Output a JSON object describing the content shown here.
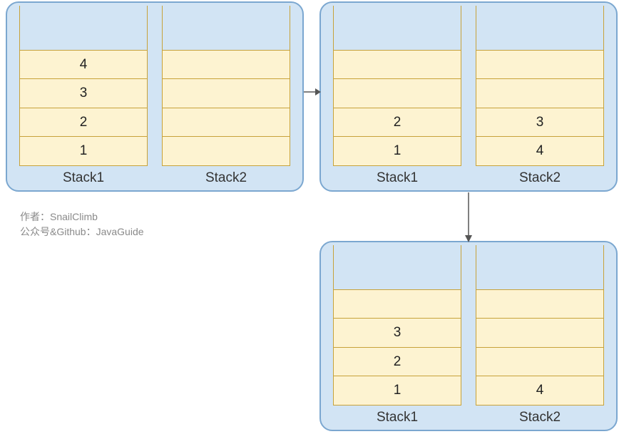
{
  "labels": {
    "stack1": "Stack1",
    "stack2": "Stack2"
  },
  "panels": [
    {
      "id": "panel-1",
      "stack1": [
        "1",
        "2",
        "3",
        "4"
      ],
      "stack2": []
    },
    {
      "id": "panel-2",
      "stack1": [
        "1",
        "2"
      ],
      "stack2": [
        "4",
        "3"
      ]
    },
    {
      "id": "panel-3",
      "stack1": [
        "1",
        "2",
        "3"
      ],
      "stack2": [
        "4"
      ]
    }
  ],
  "credit": {
    "line1": "作者：SnailClimb",
    "line2": "公众号&Github：JavaGuide"
  }
}
